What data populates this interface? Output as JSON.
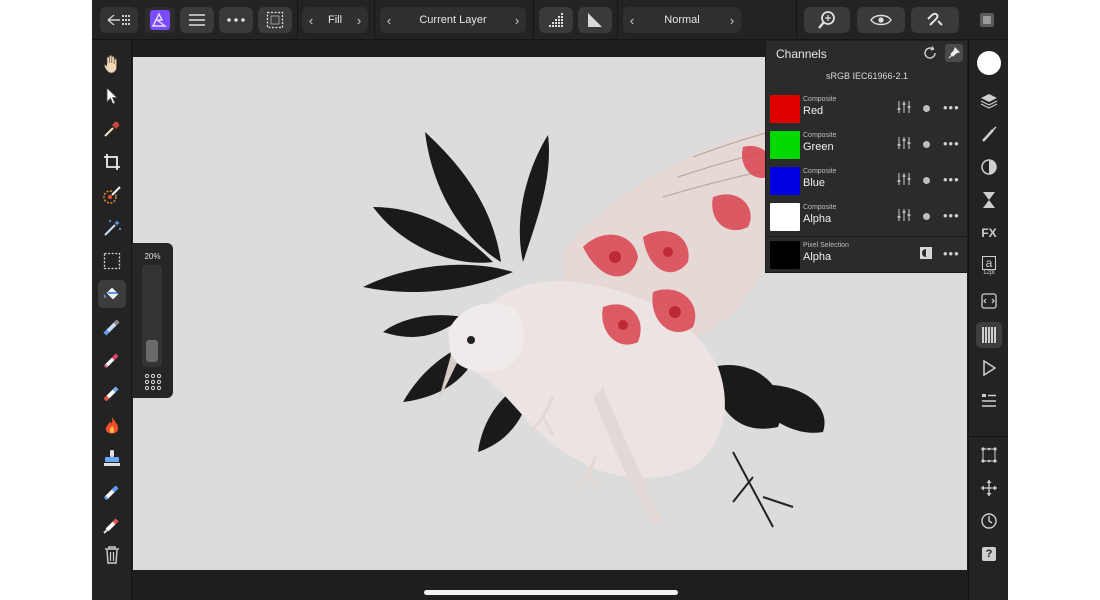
{
  "toolbar": {
    "back_icon": "back-arrow-grid-icon",
    "fill_label": "Fill",
    "layer_label": "Current Layer",
    "blend_label": "Normal"
  },
  "brush_popup": {
    "size_label": "20%",
    "size_value": 0.2
  },
  "channels": {
    "title": "Channels",
    "profile": "sRGB IEC61966-2.1",
    "rows": [
      {
        "caption": "Composite",
        "name": "Red",
        "color": "#e00000"
      },
      {
        "caption": "Composite",
        "name": "Green",
        "color": "#00d800"
      },
      {
        "caption": "Composite",
        "name": "Blue",
        "color": "#0000e0"
      },
      {
        "caption": "Composite",
        "name": "Alpha",
        "color": "#ffffff"
      },
      {
        "caption": "Pixel Selection",
        "name": "Alpha",
        "color": "#000000"
      }
    ]
  },
  "right_studio": {
    "labels": {
      "fx": "FX",
      "a": "a",
      "pt": "12pt",
      "help": "?"
    }
  },
  "colors": {
    "accent": "#7b4cff",
    "canvas": "#dcdcdc",
    "ui_dark": "#232323"
  }
}
